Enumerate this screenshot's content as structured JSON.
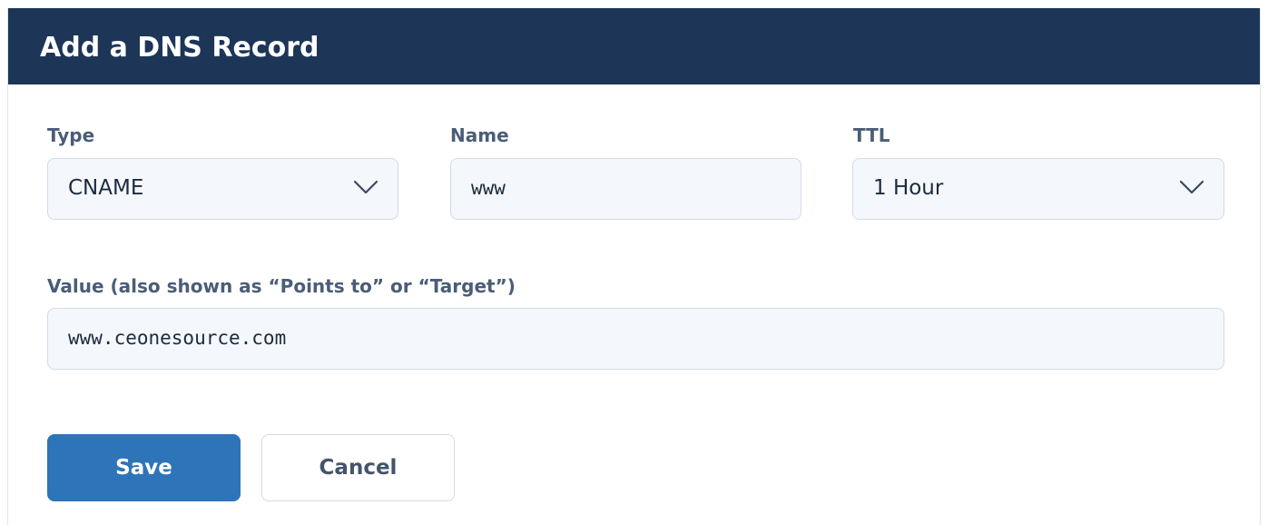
{
  "dialog": {
    "title": "Add a DNS Record"
  },
  "fields": {
    "type": {
      "label": "Type",
      "value": "CNAME",
      "icon": "chevron-down-icon"
    },
    "name": {
      "label": "Name",
      "value": "www"
    },
    "ttl": {
      "label": "TTL",
      "value": "1 Hour",
      "icon": "chevron-down-icon"
    },
    "value": {
      "label": "Value  (also shown as “Points to” or “Target”)",
      "value": "www.ceonesource.com"
    }
  },
  "buttons": {
    "save_label": "Save",
    "cancel_label": "Cancel"
  },
  "colors": {
    "header_bg": "#1d3557",
    "primary": "#2e74b8",
    "label": "#4a5d78",
    "field_bg": "#f4f7fb",
    "field_border": "#d3dbe6"
  }
}
